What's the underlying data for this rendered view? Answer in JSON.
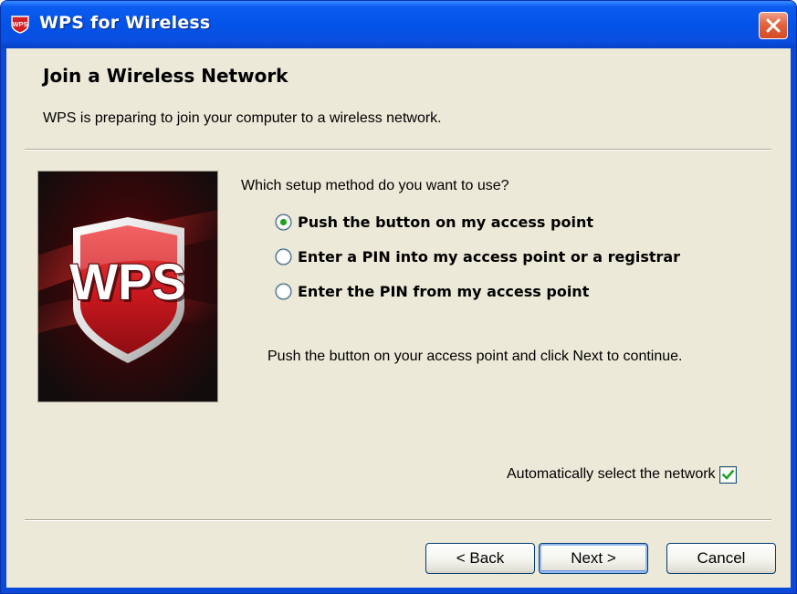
{
  "window": {
    "title": "WPS for Wireless",
    "icon": "wps-app-icon",
    "close_icon": "close-icon"
  },
  "header": {
    "title": "Join a Wireless Network",
    "subtitle": "WPS is preparing to join your computer to a wireless network."
  },
  "image": {
    "logo_text": "WPS"
  },
  "setup": {
    "question": "Which setup method do you want to use?",
    "options": [
      {
        "label": "Push the button on my access point",
        "selected": true
      },
      {
        "label": "Enter a PIN into my access point or a registrar",
        "selected": false
      },
      {
        "label": "Enter the PIN from my access point",
        "selected": false
      }
    ],
    "instruction": "Push the button on your access point and click Next to continue."
  },
  "auto_select": {
    "label": "Automatically select the network",
    "checked": true
  },
  "buttons": {
    "back": "< Back",
    "next": "Next >",
    "cancel": "Cancel"
  },
  "colors": {
    "title_bar": "#0453e8",
    "dialog_bg": "#ece9d8",
    "close_button": "#e3643f",
    "checkbox_check": "#21a121",
    "radio_dot": "#21a121",
    "logo_red": "#d41f26"
  }
}
